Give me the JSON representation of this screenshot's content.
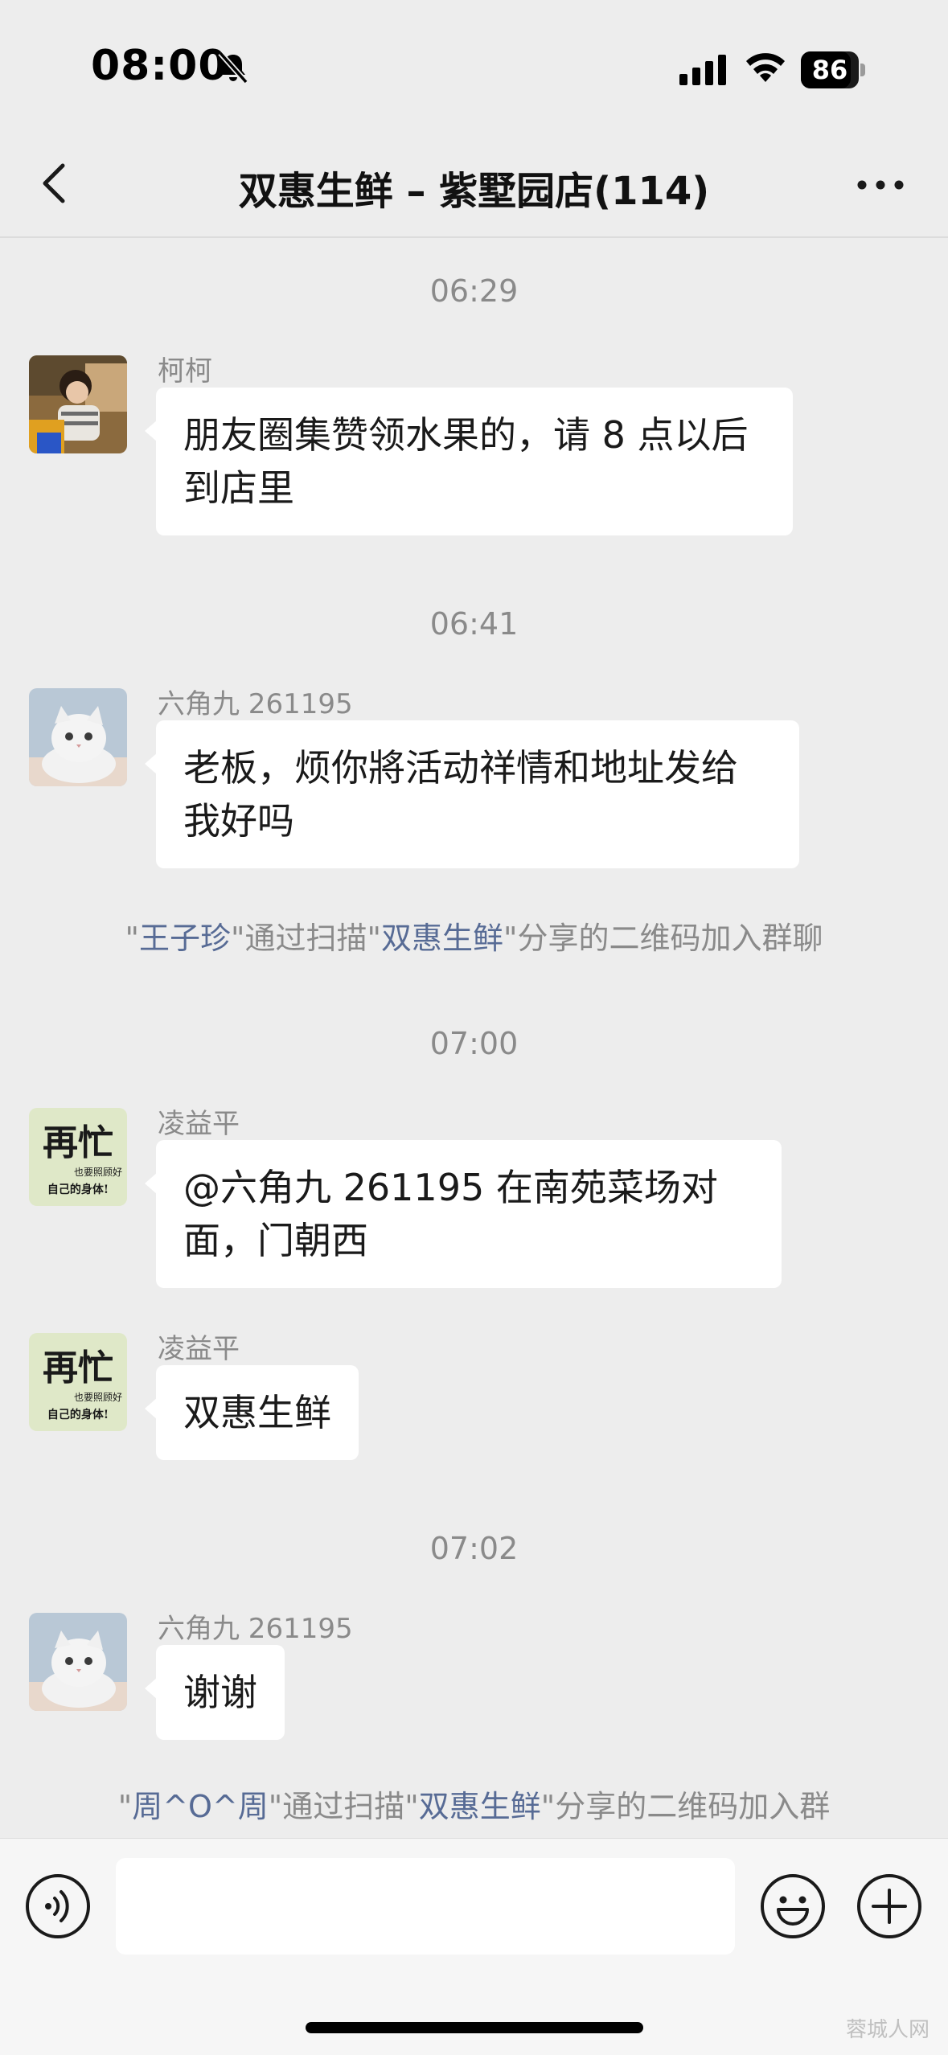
{
  "status_bar": {
    "time": "08:00",
    "battery": "86",
    "battery_fraction": 0.86
  },
  "nav": {
    "title": "双惠生鲜 – 紫墅园店(114)"
  },
  "messages": [
    {
      "type": "time",
      "text": "06:29"
    },
    {
      "type": "msg",
      "sender": "柯柯",
      "avatar": "girl-photo",
      "text": "朋友圈集赞领水果的，请 8 点以后到店里"
    },
    {
      "type": "time",
      "text": "06:41"
    },
    {
      "type": "msg",
      "sender": "六角九 261195",
      "avatar": "white-cat",
      "text": "老板，烦你將活动祥情和地址发给我好吗"
    },
    {
      "type": "system",
      "parts": [
        "\"",
        "王子珍",
        "\"通过扫描\"",
        "双惠生鲜",
        "\"分享的二维码加入群聊"
      ]
    },
    {
      "type": "time",
      "text": "07:00"
    },
    {
      "type": "msg",
      "sender": "凌益平",
      "avatar": "calligraphy",
      "text": "@六角九 261195 在南苑菜场对面，门朝西"
    },
    {
      "type": "msg",
      "sender": "凌益平",
      "avatar": "calligraphy",
      "text": "双惠生鲜"
    },
    {
      "type": "time",
      "text": "07:02"
    },
    {
      "type": "msg",
      "sender": "六角九 261195",
      "avatar": "white-cat",
      "text": "谢谢"
    },
    {
      "type": "system",
      "parts": [
        "\"",
        "周^O^周",
        "\"通过扫描\"",
        "双惠生鲜",
        "\"分享的二维码加入群"
      ]
    }
  ],
  "avatar_text": {
    "calligraphy_big": "再忙",
    "calligraphy_small1": "也要照顾好",
    "calligraphy_small2": "自己的身体!"
  },
  "input": {
    "value": ""
  },
  "watermark": "蓉城人网",
  "icons": [
    "back-icon",
    "more-icon",
    "bell-slash-icon",
    "signal-icon",
    "wifi-icon",
    "battery-icon",
    "voice-icon",
    "emoji-icon",
    "plus-icon"
  ],
  "colors": {
    "background": "#ededed",
    "bubble": "#ffffff",
    "link": "#576b95",
    "muted": "#8a8a8a"
  }
}
